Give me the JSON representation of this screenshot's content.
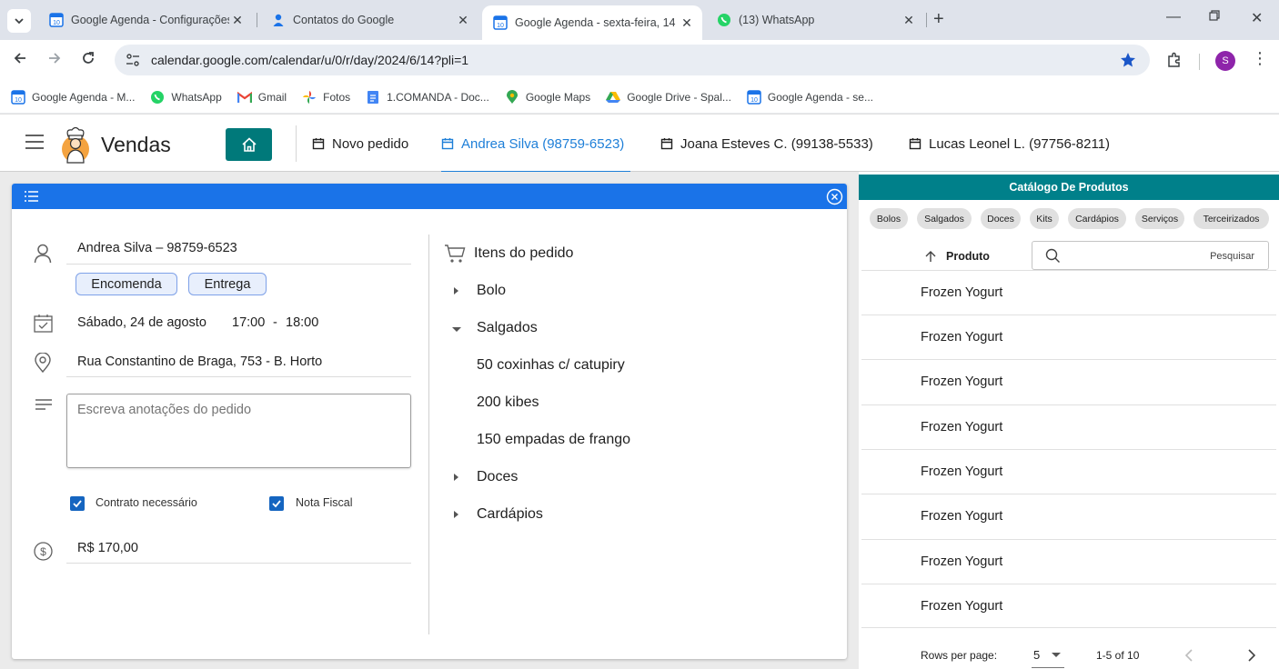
{
  "browser": {
    "tabs": [
      {
        "title": "Google Agenda - Configurações",
        "favicon": "calendar-icon"
      },
      {
        "title": "Contatos do Google",
        "favicon": "contacts-icon"
      },
      {
        "title": "Google Agenda - sexta-feira, 14",
        "favicon": "calendar-icon",
        "active": true
      },
      {
        "title": "(13) WhatsApp",
        "favicon": "whatsapp-icon"
      }
    ],
    "url": "calendar.google.com/calendar/u/0/r/day/2024/6/14?pli=1",
    "profile_initial": "S",
    "bookmarks": [
      {
        "label": "Google Agenda - M...",
        "icon": "calendar-icon"
      },
      {
        "label": "WhatsApp",
        "icon": "whatsapp-icon"
      },
      {
        "label": "Gmail",
        "icon": "gmail-icon"
      },
      {
        "label": "Fotos",
        "icon": "photos-icon"
      },
      {
        "label": "1.COMANDA - Doc...",
        "icon": "docs-icon"
      },
      {
        "label": "Google Maps",
        "icon": "maps-icon"
      },
      {
        "label": "Google Drive - Spal...",
        "icon": "drive-icon"
      },
      {
        "label": "Google Agenda - se...",
        "icon": "calendar-icon"
      }
    ]
  },
  "app": {
    "brand": "Vendas",
    "tabs": [
      {
        "label": "Novo pedido"
      },
      {
        "label": "Andrea Silva (98759-6523)",
        "active": true
      },
      {
        "label": "Joana Esteves C. (99138-5533)"
      },
      {
        "label": "Lucas Leonel L. (97756-8211)"
      }
    ],
    "accent": "#1a73e8",
    "brand_color": "#00797a"
  },
  "order": {
    "customer": "Andrea Silva – 98759-6523",
    "chips": [
      "Encomenda",
      "Entrega"
    ],
    "date": "Sábado, 24 de agosto",
    "time_start": "17:00",
    "time_sep": "-",
    "time_end": "18:00",
    "address": "Rua Constantino de Braga, 753 - B. Horto",
    "notes_placeholder": "Escreva anotações do pedido",
    "checkboxes": [
      {
        "label": "Contrato necessário",
        "checked": true
      },
      {
        "label": "Nota Fiscal",
        "checked": true
      }
    ],
    "total": "R$ 170,00",
    "items_title": "Itens do pedido",
    "tree": [
      {
        "label": "Bolo",
        "expanded": false
      },
      {
        "label": "Salgados",
        "expanded": true,
        "children": [
          "50 coxinhas c/ catupiry",
          "200 kibes",
          "150 empadas de frango"
        ]
      },
      {
        "label": "Doces",
        "expanded": false
      },
      {
        "label": "Cardápios",
        "expanded": false
      }
    ]
  },
  "catalog": {
    "title": "Catálogo De Produtos",
    "categories": [
      "Bolos",
      "Salgados",
      "Doces",
      "Kits",
      "Cardápios",
      "Serviços",
      "Terceirizados"
    ],
    "column_header": "Produto",
    "search_placeholder": "Pesquisar",
    "rows": [
      "Frozen Yogurt",
      "Frozen Yogurt",
      "Frozen Yogurt",
      "Frozen Yogurt",
      "Frozen Yogurt",
      "Frozen Yogurt",
      "Frozen Yogurt",
      "Frozen Yogurt"
    ],
    "rows_per_page_label": "Rows per page:",
    "rows_per_page": "5",
    "range": "1-5 of 10"
  }
}
